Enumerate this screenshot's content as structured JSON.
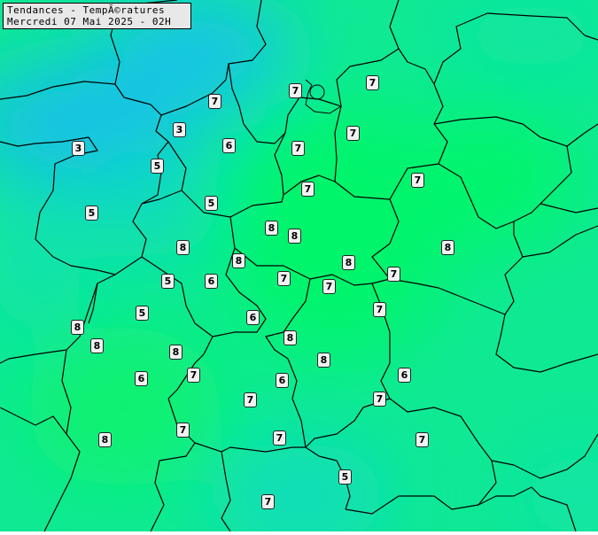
{
  "title": {
    "line1": "Tendances - TempÃ©ratures",
    "line2": "Mercredi 07 Mai 2025 - 02H"
  },
  "colors": {
    "cold": "#12c0e8",
    "cool": "#0ddcbc",
    "mild": "#0fe994",
    "warm": "#06f56a",
    "border": "#000000",
    "label_bg": "#f2f2f2"
  },
  "stations": [
    {
      "value": "7"
    },
    {
      "value": "7"
    },
    {
      "value": "7"
    },
    {
      "value": "3"
    },
    {
      "value": "3"
    },
    {
      "value": "6"
    },
    {
      "value": "7"
    },
    {
      "value": "7"
    },
    {
      "value": "5"
    },
    {
      "value": "7"
    },
    {
      "value": "7"
    },
    {
      "value": "5"
    },
    {
      "value": "5"
    },
    {
      "value": "8"
    },
    {
      "value": "8"
    },
    {
      "value": "8"
    },
    {
      "value": "8"
    },
    {
      "value": "8"
    },
    {
      "value": "8"
    },
    {
      "value": "7"
    },
    {
      "value": "5"
    },
    {
      "value": "6"
    },
    {
      "value": "7"
    },
    {
      "value": "7"
    },
    {
      "value": "5"
    },
    {
      "value": "6"
    },
    {
      "value": "7"
    },
    {
      "value": "8"
    },
    {
      "value": "8"
    },
    {
      "value": "8"
    },
    {
      "value": "8"
    },
    {
      "value": "8"
    },
    {
      "value": "7"
    },
    {
      "value": "6"
    },
    {
      "value": "6"
    },
    {
      "value": "6"
    },
    {
      "value": "7"
    },
    {
      "value": "7"
    },
    {
      "value": "8"
    },
    {
      "value": "7"
    },
    {
      "value": "7"
    },
    {
      "value": "5"
    },
    {
      "value": "7"
    }
  ]
}
